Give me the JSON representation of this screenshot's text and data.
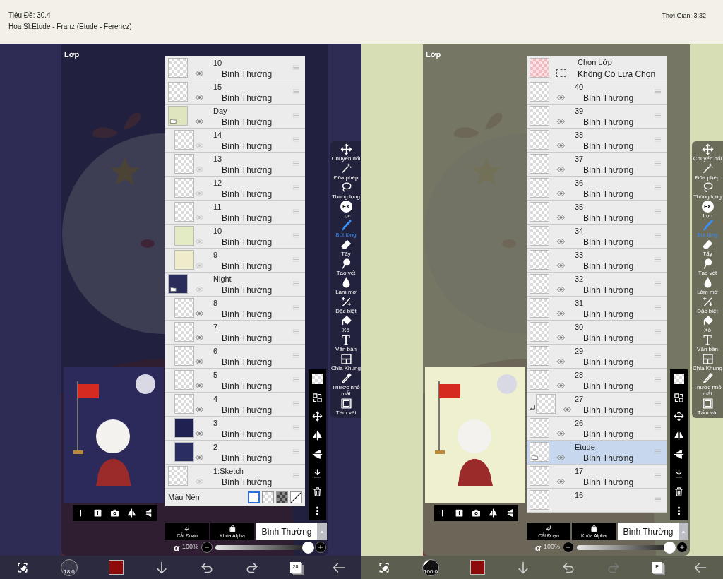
{
  "screens": [
    {
      "info": [
        "Tiêu Đề: 30.4",
        "Họa Sĩ:Etude - Franz (Etude - Ferencz)"
      ],
      "panel_title": "Lớp",
      "layers": [
        {
          "kind": "layer",
          "name": "10",
          "mode": "Bình Thường",
          "visible": true,
          "selected": false,
          "clipping": false
        },
        {
          "kind": "layer",
          "name": "15",
          "mode": "Bình Thường",
          "visible": true,
          "selected": false,
          "clipping": false
        },
        {
          "kind": "folder",
          "name": "Day",
          "mode": "Bình Thường",
          "visible": true,
          "selected": false,
          "clipping": false,
          "color": "#dfe6bf",
          "children": [
            {
              "kind": "layer",
              "name": "14",
              "mode": "Bình Thường",
              "visible": false,
              "selected": false,
              "clipping": false
            },
            {
              "kind": "layer",
              "name": "13",
              "mode": "Bình Thường",
              "visible": false,
              "selected": false,
              "clipping": false
            },
            {
              "kind": "layer",
              "name": "12",
              "mode": "Bình Thường",
              "visible": false,
              "selected": false,
              "clipping": false
            },
            {
              "kind": "layer",
              "name": "11",
              "mode": "Bình Thường",
              "visible": false,
              "selected": false,
              "clipping": false
            },
            {
              "kind": "layer",
              "name": "10",
              "mode": "Bình Thường",
              "visible": false,
              "selected": false,
              "clipping": false,
              "color": "#e3ebc4"
            },
            {
              "kind": "layer",
              "name": "9",
              "mode": "Bình Thường",
              "visible": false,
              "selected": false,
              "clipping": false,
              "color": "#efeccb"
            }
          ]
        },
        {
          "kind": "folder",
          "name": "Night",
          "mode": "Bình Thường",
          "visible": false,
          "selected": false,
          "clipping": false,
          "color": "#2a2c5c",
          "children": [
            {
              "kind": "layer",
              "name": "8",
              "mode": "Bình Thường",
              "visible": true,
              "selected": false,
              "clipping": false
            },
            {
              "kind": "layer",
              "name": "7",
              "mode": "Bình Thường",
              "visible": true,
              "selected": false,
              "clipping": false
            },
            {
              "kind": "layer",
              "name": "6",
              "mode": "Bình Thường",
              "visible": true,
              "selected": false,
              "clipping": false
            },
            {
              "kind": "layer",
              "name": "5",
              "mode": "Bình Thường",
              "visible": true,
              "selected": false,
              "clipping": false
            },
            {
              "kind": "layer",
              "name": "4",
              "mode": "Bình Thường",
              "visible": true,
              "selected": false,
              "clipping": false
            },
            {
              "kind": "layer",
              "name": "3",
              "mode": "Bình Thường",
              "visible": true,
              "selected": false,
              "clipping": false,
              "color": "#1f2150"
            },
            {
              "kind": "layer",
              "name": "2",
              "mode": "Bình Thường",
              "visible": true,
              "selected": false,
              "clipping": false,
              "color": "#2a2d62"
            }
          ]
        },
        {
          "kind": "layer",
          "name": "1:Sketch",
          "mode": "Bình Thường",
          "visible": false,
          "selected": false,
          "clipping": false
        }
      ],
      "background_row": {
        "label": "Màu Nền",
        "swatches": [
          {
            "kind": "white",
            "selected": true
          },
          {
            "kind": "checker",
            "selected": false
          },
          {
            "kind": "dark-checker",
            "selected": false
          },
          {
            "kind": "none",
            "selected": false
          }
        ]
      },
      "layer_actions": [
        "Cắt Đoạn",
        "Khóa Alpha"
      ],
      "blend_mode": "Bình Thường",
      "opacity": {
        "symbol": "α",
        "label": "100%",
        "level": 1
      },
      "tools": [
        {
          "label": "Chuyển đổi",
          "selected": false
        },
        {
          "label": "Đũa phép",
          "selected": false
        },
        {
          "label": "Thòng lọng",
          "selected": false
        },
        {
          "label": "Lọc",
          "selected": false,
          "icon_text": "FX"
        },
        {
          "label": "Bút lông",
          "selected": true
        },
        {
          "label": "Tẩy",
          "selected": false
        },
        {
          "label": "Tạo vết",
          "selected": false
        },
        {
          "label": "Làm mờ",
          "selected": false
        },
        {
          "label": "Đặc biệt",
          "selected": false
        },
        {
          "label": "Xô",
          "selected": false
        },
        {
          "label": "Văn bản",
          "selected": false,
          "icon_text": "T"
        },
        {
          "label": "Chia Khung",
          "selected": false
        },
        {
          "label": "Thước nhỏ mắt",
          "selected": false
        },
        {
          "label": "Tấm vải",
          "selected": false
        }
      ],
      "bottom_bar": {
        "brush_size": "18.0",
        "layer_label": "28",
        "redo_disabled": false
      }
    },
    {
      "time": "Thời Gian: 3:32",
      "panel_title": "Lớp",
      "layers": [
        {
          "kind": "selection",
          "name": "Chọn Lớp",
          "subtitle": "Không Có Lựa Chọn",
          "selected": false
        },
        {
          "kind": "layer",
          "name": "40",
          "mode": "Bình Thường",
          "visible": true,
          "selected": false,
          "clipping": false
        },
        {
          "kind": "layer",
          "name": "39",
          "mode": "Bình Thường",
          "visible": true,
          "selected": false,
          "clipping": false
        },
        {
          "kind": "layer",
          "name": "38",
          "mode": "Bình Thường",
          "visible": true,
          "selected": false,
          "clipping": false
        },
        {
          "kind": "layer",
          "name": "37",
          "mode": "Bình Thường",
          "visible": true,
          "selected": false,
          "clipping": false
        },
        {
          "kind": "layer",
          "name": "36",
          "mode": "Bình Thường",
          "visible": true,
          "selected": false,
          "clipping": false
        },
        {
          "kind": "layer",
          "name": "35",
          "mode": "Bình Thường",
          "visible": true,
          "selected": false,
          "clipping": false
        },
        {
          "kind": "layer",
          "name": "34",
          "mode": "Bình Thường",
          "visible": true,
          "selected": false,
          "clipping": false
        },
        {
          "kind": "layer",
          "name": "33",
          "mode": "Bình Thường",
          "visible": true,
          "selected": false,
          "clipping": false
        },
        {
          "kind": "layer",
          "name": "32",
          "mode": "Bình Thường",
          "visible": true,
          "selected": false,
          "clipping": false
        },
        {
          "kind": "layer",
          "name": "31",
          "mode": "Bình Thường",
          "visible": true,
          "selected": false,
          "clipping": false
        },
        {
          "kind": "layer",
          "name": "30",
          "mode": "Bình Thường",
          "visible": true,
          "selected": false,
          "clipping": false
        },
        {
          "kind": "layer",
          "name": "29",
          "mode": "Bình Thường",
          "visible": true,
          "selected": false,
          "clipping": false
        },
        {
          "kind": "layer",
          "name": "28",
          "mode": "Bình Thường",
          "visible": true,
          "selected": false,
          "clipping": false
        },
        {
          "kind": "layer",
          "name": "27",
          "mode": "Bình Thường",
          "visible": true,
          "selected": false,
          "clipping": true
        },
        {
          "kind": "layer",
          "name": "26",
          "mode": "Bình Thường",
          "visible": true,
          "selected": false,
          "clipping": false
        },
        {
          "kind": "folder",
          "name": "Etude",
          "mode": "Bình Thường",
          "visible": true,
          "selected": true,
          "clipping": false
        },
        {
          "kind": "layer",
          "name": "17",
          "mode": "Bình Thường",
          "visible": true,
          "selected": false,
          "clipping": false
        },
        {
          "kind": "layer",
          "name": "16",
          "selected": false,
          "clipping": false
        }
      ],
      "layer_actions": [
        "Cắt Đoạn",
        "Khóa Alpha"
      ],
      "blend_mode": "Bình Thường",
      "opacity": {
        "symbol": "α",
        "label": "100%",
        "level": 1
      },
      "tools": [
        {
          "label": "Chuyển đổi",
          "selected": false
        },
        {
          "label": "Đũa phép",
          "selected": false
        },
        {
          "label": "Thòng lọng",
          "selected": false
        },
        {
          "label": "Lọc",
          "selected": false,
          "icon_text": "FX"
        },
        {
          "label": "Bút lông",
          "selected": true
        },
        {
          "label": "Tẩy",
          "selected": false
        },
        {
          "label": "Tạo vết",
          "selected": false
        },
        {
          "label": "Làm mờ",
          "selected": false
        },
        {
          "label": "Đặc biệt",
          "selected": false
        },
        {
          "label": "Xô",
          "selected": false
        },
        {
          "label": "Văn bản",
          "selected": false,
          "icon_text": "T"
        },
        {
          "label": "Chia Khung",
          "selected": false
        },
        {
          "label": "Thước nhỏ mắt",
          "selected": false
        },
        {
          "label": "Tấm vải",
          "selected": false
        }
      ],
      "bottom_bar": {
        "brush_size": "100.0",
        "layer_label": "F",
        "redo_disabled": true
      }
    }
  ]
}
